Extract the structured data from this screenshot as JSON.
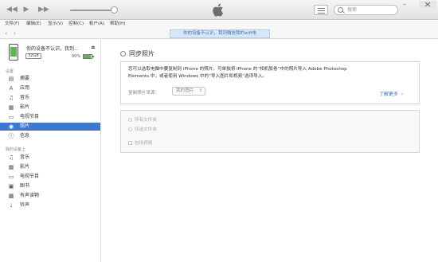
{
  "titlebar": {
    "search_placeholder": "搜索"
  },
  "menu": {
    "items": [
      "文件(F)",
      "编辑(E)",
      "显示(V)",
      "控制(C)",
      "帐户(A)",
      "帮助(H)"
    ]
  },
  "nav": {
    "banner": "你的设备不认识，我到微信我的wifi电"
  },
  "device": {
    "name": "你的设备不认识，我到...",
    "capacity": "32GB",
    "battery": "90%",
    "battery_level": 0.9
  },
  "sidebar": {
    "settings_label": "设置",
    "settings": [
      {
        "label": "摘要",
        "icon": "summary-icon"
      },
      {
        "label": "应用",
        "icon": "apps-icon"
      },
      {
        "label": "音乐",
        "icon": "music-icon"
      },
      {
        "label": "影片",
        "icon": "movies-icon"
      },
      {
        "label": "电视节目",
        "icon": "tv-icon"
      },
      {
        "label": "照片",
        "icon": "photos-icon"
      },
      {
        "label": "信息",
        "icon": "info-icon"
      }
    ],
    "ondevice_label": "我的设备上",
    "ondevice": [
      {
        "label": "音乐",
        "icon": "music-icon"
      },
      {
        "label": "影片",
        "icon": "movies-icon"
      },
      {
        "label": "电视节目",
        "icon": "tv-icon"
      },
      {
        "label": "图书",
        "icon": "books-icon"
      },
      {
        "label": "有声读物",
        "icon": "audiobooks-icon"
      },
      {
        "label": "铃声",
        "icon": "tones-icon"
      }
    ]
  },
  "main": {
    "sync_title": "同步照片",
    "info_line1": "您可以选取电脑中要复制到 iPhone 的照片。可单独将 iPhone 的“相机胶卷”中的照片导入 Adobe Photoshop",
    "info_line2": "Elements 中，或者使用 Windows 中的“导入图片和视频”选项导入。",
    "copy_from_label": "复制照片来源：",
    "copy_from_value": "我的图片",
    "learn_more": "了解更多",
    "options": {
      "all_folders": "所有文件夹",
      "selected_folders": "所选文件夹",
      "include_videos": "包括视频"
    }
  }
}
